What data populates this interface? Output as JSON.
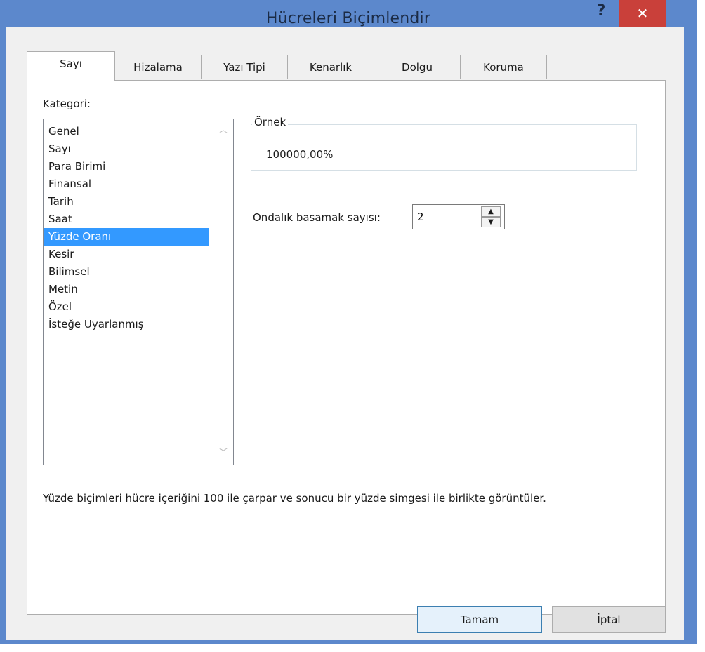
{
  "window": {
    "title": "Hücreleri Biçimlendir"
  },
  "titlebar": {
    "help_glyph": "?",
    "close_glyph": "✕"
  },
  "tabs": [
    {
      "label": "Sayı",
      "active": true
    },
    {
      "label": "Hizalama",
      "active": false
    },
    {
      "label": "Yazı Tipi",
      "active": false
    },
    {
      "label": "Kenarlık",
      "active": false
    },
    {
      "label": "Dolgu",
      "active": false
    },
    {
      "label": "Koruma",
      "active": false
    }
  ],
  "category": {
    "label": "Kategori:",
    "items": [
      "Genel",
      "Sayı",
      "Para Birimi",
      "Finansal",
      "Tarih",
      "Saat",
      "Yüzde Oranı",
      "Kesir",
      "Bilimsel",
      "Metin",
      "Özel",
      "İsteğe Uyarlanmış"
    ],
    "selected": "Yüzde Oranı"
  },
  "sample": {
    "label": "Örnek",
    "value": "100000,00%"
  },
  "decimal": {
    "label": "Ondalık basamak sayısı:",
    "value": "2"
  },
  "description": "Yüzde biçimleri hücre içeriğini 100 ile çarpar ve sonucu bir yüzde simgesi ile birlikte görüntüler.",
  "buttons": {
    "ok": "Tamam",
    "cancel": "İptal"
  },
  "colors": {
    "titlebar": "#5c88cc",
    "close": "#c9403a",
    "selection": "#3399ff"
  }
}
